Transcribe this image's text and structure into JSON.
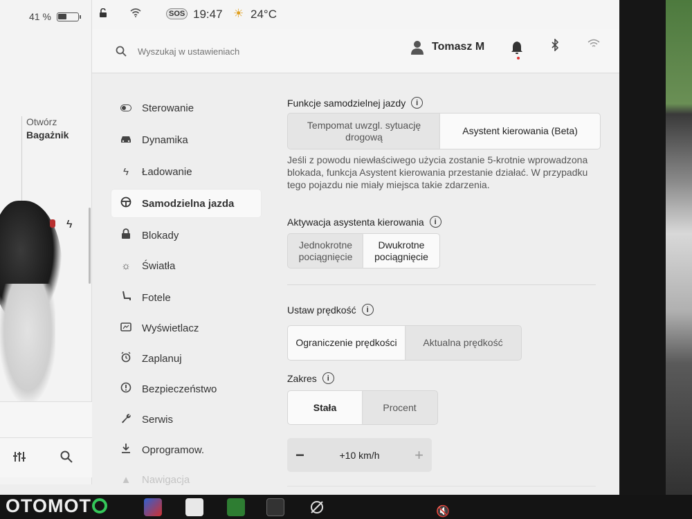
{
  "statusbar": {
    "battery_percent": "41 %",
    "sos": "SOS",
    "time": "19:47",
    "temperature": "24°C"
  },
  "car": {
    "trunk_action": "Otwórz",
    "trunk_label": "Bagażnik"
  },
  "header": {
    "search_placeholder": "Wyszukaj w ustawieniach",
    "user_name": "Tomasz M"
  },
  "nav": {
    "items": [
      {
        "label": "Sterowanie",
        "icon": "toggle-icon"
      },
      {
        "label": "Dynamika",
        "icon": "car-icon"
      },
      {
        "label": "Ładowanie",
        "icon": "bolt-icon"
      },
      {
        "label": "Samodzielna jazda",
        "icon": "steering-wheel-icon",
        "active": true
      },
      {
        "label": "Blokady",
        "icon": "lock-icon"
      },
      {
        "label": "Światła",
        "icon": "light-icon"
      },
      {
        "label": "Fotele",
        "icon": "seat-icon"
      },
      {
        "label": "Wyświetlacz",
        "icon": "display-icon"
      },
      {
        "label": "Zaplanuj",
        "icon": "alarm-clock-icon"
      },
      {
        "label": "Bezpieczeństwo",
        "icon": "alert-icon"
      },
      {
        "label": "Serwis",
        "icon": "wrench-icon"
      },
      {
        "label": "Oprogramow.",
        "icon": "download-icon"
      },
      {
        "label": "Nawigacja",
        "icon": "navigation-icon"
      }
    ]
  },
  "autopilot": {
    "features_title": "Funkcje samodzielnej jazdy",
    "feature_options": [
      "Tempomat uwzgl. sytuację drogową",
      "Asystent kierowania (Beta)"
    ],
    "feature_selected": "Asystent kierowania (Beta)",
    "warning_text": "Jeśli z powodu niewłaściwego użycia zostanie 5-krotnie wprowadzona blokada, funkcja Asystent kierowania przestanie działać. W przypadku tego pojazdu nie miały miejsca takie zdarzenia.",
    "activation_title": "Aktywacja asystenta kierowania",
    "activation_options": [
      "Jednokrotne pociągnięcie",
      "Dwukrotne pociągnięcie"
    ],
    "activation_selected": "Dwukrotne pociągnięcie",
    "speed_title": "Ustaw prędkość",
    "speed_options": [
      "Ograniczenie prędkości",
      "Aktualna prędkość"
    ],
    "speed_selected": "Ograniczenie prędkości",
    "range_title": "Zakres",
    "range_options": [
      "Stała",
      "Procent"
    ],
    "range_selected": "Stała",
    "offset_value": "+10 km/h"
  },
  "watermark": "OTOMOTO",
  "colors": {
    "screen_bg": "#eeeeee",
    "selected_bg": "#fafafa",
    "segment_bg": "#e5e5e5",
    "notification_dot": "#dd3333",
    "brand_green": "#34c759"
  }
}
